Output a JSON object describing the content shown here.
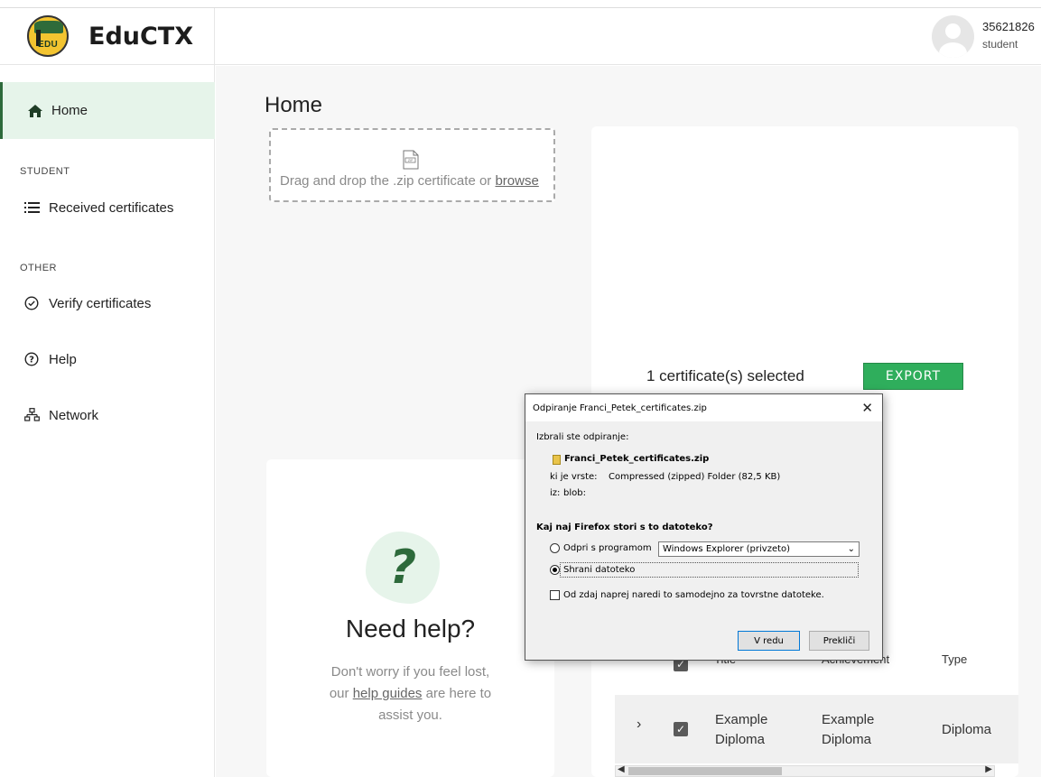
{
  "brand": {
    "name": "EduCTX",
    "logo_text": "EDU"
  },
  "sidebar": {
    "home": "Home",
    "student_section": "STUDENT",
    "received": "Received certificates",
    "other_section": "OTHER",
    "verify": "Verify certificates",
    "help": "Help",
    "network": "Network"
  },
  "user": {
    "id": "35621826",
    "role": "student"
  },
  "main": {
    "title": "Home",
    "dropzone_text": "Drag and drop the .zip certificate or ",
    "dropzone_link": "browse",
    "selected_count": "1 certificate(s) selected",
    "export_label": "EXPORT"
  },
  "table": {
    "headers": [
      "Title",
      "Achievement",
      "Type"
    ],
    "rows": [
      {
        "title_line1": "Example",
        "title_line2": "Diploma",
        "achievement_line1": "Example",
        "achievement_line2": "Diploma",
        "type": "Diploma",
        "checked": true
      }
    ]
  },
  "help": {
    "title": "Need help?",
    "line1": "Don't worry if you feel lost,",
    "line2_prefix": "our ",
    "line2_link": "help guides",
    "line2_suffix": " are here to",
    "line3": "assist you."
  },
  "dialog": {
    "title": "Odpiranje Franci_Petek_certificates.zip",
    "chose": "Izbrali ste odpiranje:",
    "filename": "Franci_Petek_certificates.zip",
    "type_label": "ki je vrste:",
    "type_value": "Compressed (zipped) Folder (82,5 KB)",
    "from_label": "iz:",
    "from_value": "blob:",
    "question": "Kaj naj Firefox stori s to datoteko?",
    "open_with": "Odpri s programom",
    "open_with_value": "Windows Explorer (privzeto)",
    "save_file": "Shrani datoteko",
    "auto_checkbox": "Od zdaj naprej naredi to samodejno za tovrstne datoteke.",
    "ok": "V redu",
    "cancel": "Prekliči",
    "selected_option": "save"
  },
  "colors": {
    "accent": "#2d6a3b",
    "export": "#2fae5c",
    "home_bg": "#e6f4ea"
  }
}
